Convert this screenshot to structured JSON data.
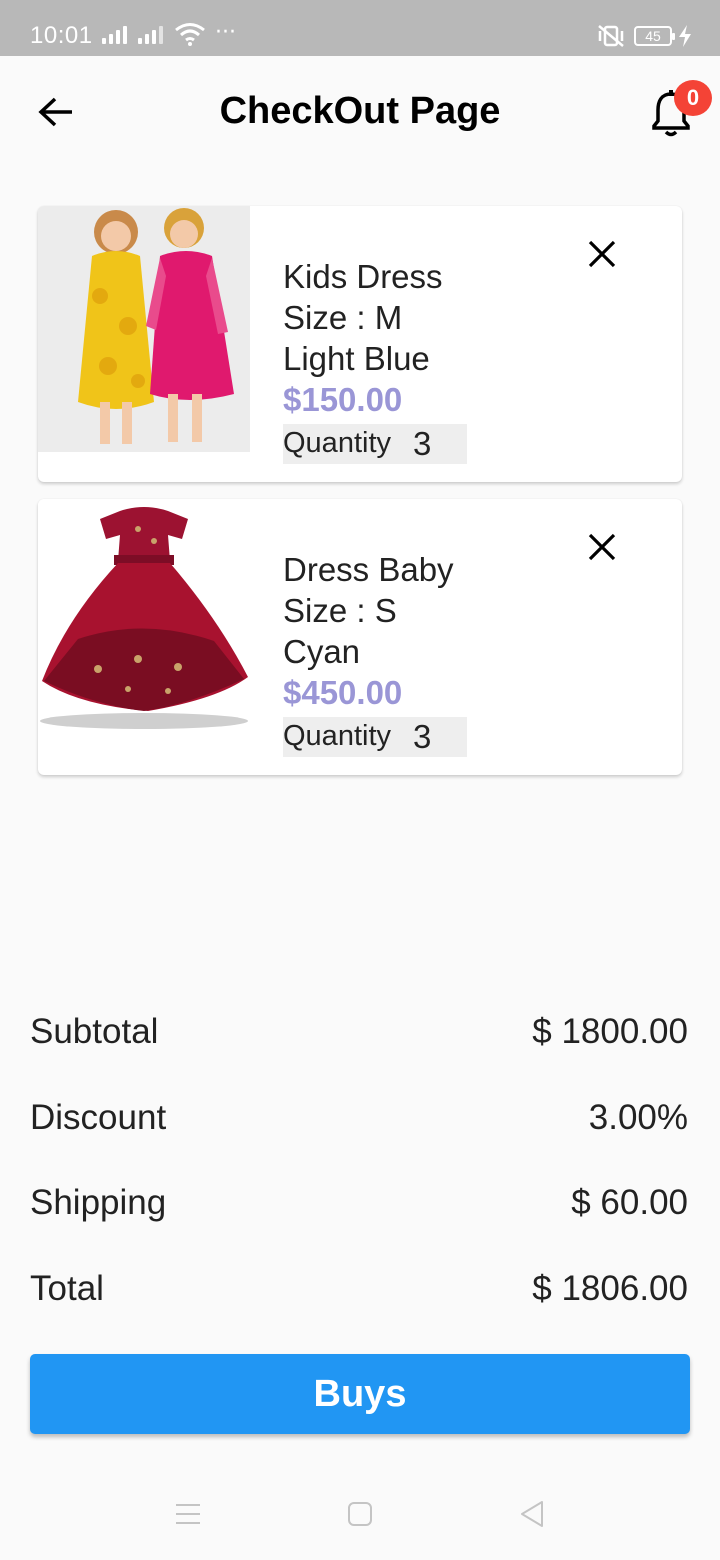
{
  "status_bar": {
    "time": "10:01",
    "more": "···",
    "battery": "45"
  },
  "app_bar": {
    "title": "CheckOut Page",
    "notification_count": "0"
  },
  "cart": {
    "items": [
      {
        "name": "Kids Dress",
        "size": "Size : M",
        "color": "Light Blue",
        "price": "$150.00",
        "quantity_label": "Quantity",
        "quantity": "3",
        "image": "two-girls-dresses-photo"
      },
      {
        "name": "Dress Baby",
        "size": "Size : S",
        "color": "Cyan",
        "price": "$450.00",
        "quantity_label": "Quantity",
        "quantity": "3",
        "image": "red-party-dress-photo"
      }
    ]
  },
  "summary": {
    "subtotal_label": "Subtotal",
    "subtotal_value": "$ 1800.00",
    "discount_label": "Discount",
    "discount_value": "3.00%",
    "shipping_label": "Shipping",
    "shipping_value": "$ 60.00",
    "total_label": "Total",
    "total_value": "$ 1806.00"
  },
  "buy_button": {
    "label": "Buys"
  },
  "colors": {
    "accent": "#2196f3",
    "price": "#9a96d6",
    "badge": "#f44336"
  }
}
